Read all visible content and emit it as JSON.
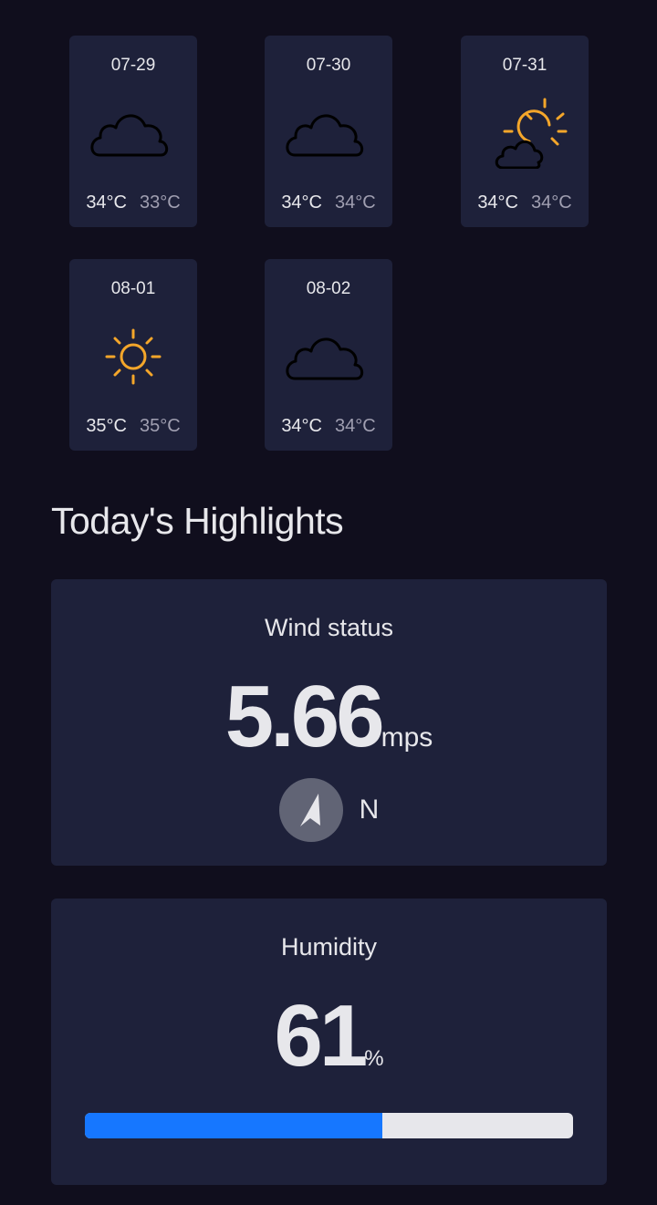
{
  "forecast": [
    {
      "date": "07-29",
      "icon": "cloud-icon",
      "max": "34°C",
      "min": "33°C"
    },
    {
      "date": "07-30",
      "icon": "cloud-icon",
      "max": "34°C",
      "min": "34°C"
    },
    {
      "date": "07-31",
      "icon": "sun-cloud-icon",
      "max": "34°C",
      "min": "34°C"
    },
    {
      "date": "08-01",
      "icon": "sun-icon",
      "max": "35°C",
      "min": "35°C"
    },
    {
      "date": "08-02",
      "icon": "cloud-icon",
      "max": "34°C",
      "min": "34°C"
    }
  ],
  "highlights": {
    "title": "Today's Highlights",
    "wind": {
      "label": "Wind status",
      "value": "5.66",
      "unit": "mps",
      "direction": "N",
      "icon": "navigation-arrow-icon"
    },
    "humidity": {
      "label": "Humidity",
      "value": "61",
      "unit": "%",
      "percent": 61
    }
  },
  "colors": {
    "background": "#100e1d",
    "card": "#1e213a",
    "text": "#e7e7eb",
    "muted": "#a09fb1",
    "sun": "#f4a62a",
    "progress": "#1677ff",
    "compass": "#616475"
  }
}
